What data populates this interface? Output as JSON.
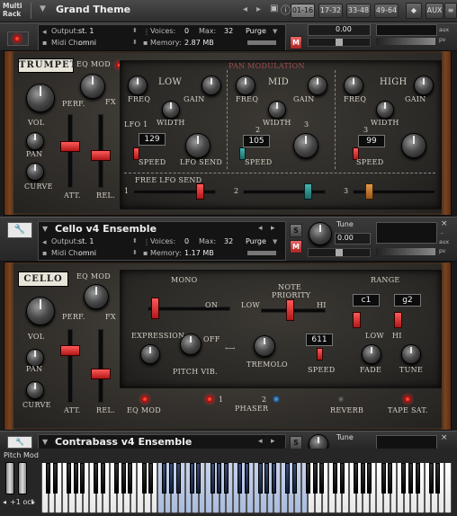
{
  "topbar": {
    "app_label": "Multi Rack",
    "multi_name": "Grand Theme",
    "pages": [
      "01-16",
      "17-32",
      "33-48",
      "49-64"
    ],
    "aux": "AUX"
  },
  "instrument1": {
    "output_label": "Output:",
    "output_value": "st. 1",
    "midi_label": "Midi Ch:",
    "midi_value": "omni",
    "voices_label": "Voices:",
    "voices_value": "0",
    "max_label": "Max:",
    "max_value": "32",
    "purge": "Purge",
    "memory_label": "Memory:",
    "memory_value": "2.87 MB",
    "m_button": "M",
    "tune_value": "0.00",
    "nameplate": "TRUMPET",
    "eq_mod": "EQ MOD",
    "perf": "PERF.",
    "fx": "FX",
    "vol": "VOL",
    "pan": "PAN",
    "curve": "CURVE",
    "att": "ATT.",
    "rel": "REL.",
    "section_title": "PAN MODULATION",
    "bands": [
      {
        "name": "LOW",
        "freq": "FREQ",
        "gain": "GAIN",
        "width": "WIDTH",
        "lfo": "LFO 1",
        "speed_value": "129",
        "speed": "SPEED",
        "lfo_send": "LFO SEND"
      },
      {
        "name": "MID",
        "freq": "FREQ",
        "gain": "GAIN",
        "width": "WIDTH",
        "lfo": "2",
        "speed_value": "105",
        "speed": "SPEED",
        "lfo_send": "3"
      },
      {
        "name": "HIGH",
        "freq": "FREQ",
        "gain": "GAIN",
        "width": "WIDTH",
        "lfo": "3",
        "speed_value": "99",
        "speed": "SPEED",
        "lfo_send": ""
      }
    ],
    "free_lfo_send": "FREE LFO SEND",
    "slider_numbers": [
      "1",
      "2",
      "3"
    ]
  },
  "instrument2": {
    "name": "Cello v4 Ensemble",
    "output_label": "Output:",
    "output_value": "st. 1",
    "midi_label": "Midi Ch:",
    "midi_value": "omni",
    "voices_label": "Voices:",
    "voices_value": "0",
    "max_label": "Max:",
    "max_value": "32",
    "purge": "Purge",
    "memory_label": "Memory:",
    "memory_value": "1.17 MB",
    "s_button": "S",
    "m_button": "M",
    "tune_label": "Tune",
    "tune_value": "0.00",
    "nameplate": "CELLO",
    "eq_mod": "EQ MOD",
    "perf": "PERF.",
    "fx": "FX",
    "vol": "VOL",
    "pan": "PAN",
    "curve": "CURVE",
    "att": "ATT.",
    "rel": "REL.",
    "mono": "MONO",
    "on": "ON",
    "low": "LOW",
    "note_priority": "NOTE PRIORITY",
    "hi": "HI",
    "range": "RANGE",
    "range_low": "c1",
    "range_high": "g2",
    "expression": "EXPRESSION",
    "pitch_vib": "PITCH VIB.",
    "off": "OFF",
    "tremolo": "TREMOLO",
    "speed_value": "611",
    "speed": "SPEED",
    "fade": "FADE",
    "tune": "TUNE",
    "low2": "LOW",
    "hi2": "HI",
    "bottom_items": [
      "EQ MOD",
      "1",
      "PHASER",
      "2",
      "REVERB",
      "TAPE SAT."
    ]
  },
  "instrument3": {
    "name": "Contrabass v4 Ensemble",
    "s_button": "S",
    "tune_label": "Tune"
  },
  "keyboard": {
    "pitch_mod": "Pitch Mod",
    "octave": "+1 oct"
  },
  "colors": {
    "fader_red": "#d02020",
    "fader_teal": "#2a8a88",
    "fader_orange": "#c07a30",
    "led_red": "#ff3a2a",
    "keyboard_active": "#b6c5e3"
  }
}
